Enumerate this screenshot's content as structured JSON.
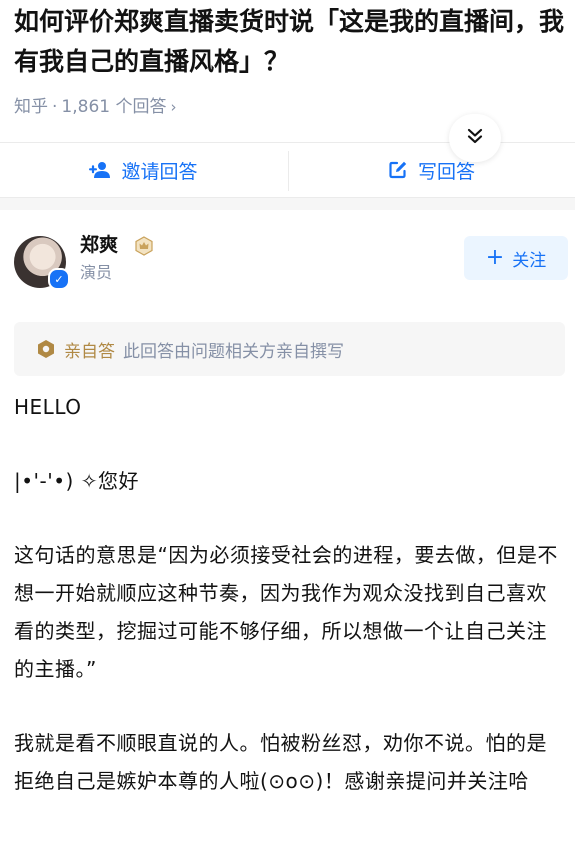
{
  "question": {
    "title": "如何评价郑爽直播卖货时说「这是我的直播间，我有我自己的直播风格」？",
    "site": "知乎",
    "separator": "·",
    "answers_count": "1,861 个回答",
    "chevron": "›"
  },
  "actions": {
    "invite_label": "邀请回答",
    "write_label": "写回答",
    "expand_glyph": "»"
  },
  "author": {
    "name": "郑爽",
    "title": "演员",
    "follow_label": "关注",
    "follow_plus": "+"
  },
  "self_answer": {
    "tag": "亲自答",
    "text": "此回答由问题相关方亲自撰写"
  },
  "answer": {
    "paragraphs": [
      "HELLO",
      "|•'-'•) ✧您好",
      "这句话的意思是“因为必须接受社会的进程，要去做，但是不想一开始就顺应这种节奏，因为我作为观众没找到自己喜欢看的类型，挖掘过可能不够仔细，所以想做一个让自己关注的主播。”",
      "我就是看不顺眼直说的人。怕被粉丝怼，劝你不说。怕的是拒绝自己是嫉妒本尊的人啦(⊙o⊙)！感谢亲提问并关注哈"
    ]
  },
  "colors": {
    "accent": "#1772f6",
    "meta_gray": "#8590a6",
    "gold": "#b08944",
    "badge_bg": "#ebf5ff"
  },
  "icons": {
    "invite": "add-user-icon",
    "write": "edit-icon",
    "expand": "double-chevron-down-icon",
    "badge": "crown-badge-icon",
    "verified": "verified-check-icon",
    "self_answer": "shield-badge-icon"
  }
}
